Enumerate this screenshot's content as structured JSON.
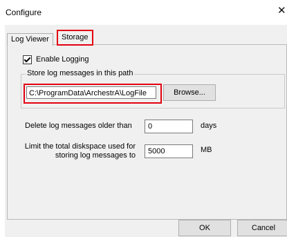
{
  "window": {
    "title": "Configure",
    "close_glyph": "✕"
  },
  "tabs": [
    {
      "label": "Log Viewer",
      "selected": false
    },
    {
      "label": "Storage",
      "selected": true
    }
  ],
  "storage": {
    "enable_logging": {
      "label": "Enable Logging",
      "checked": true
    },
    "path_group": {
      "legend": "Store log messages in this path",
      "path_value": "C:\\ProgramData\\ArchestrA\\LogFile",
      "browse_label": "Browse..."
    },
    "delete_older": {
      "label": "Delete log messages older than",
      "value": "0",
      "unit": "days"
    },
    "disk_limit": {
      "label": "Limit the total diskspace used for storing log messages to",
      "value": "5000",
      "unit": "MB"
    }
  },
  "footer": {
    "ok_label": "OK",
    "cancel_label": "Cancel"
  },
  "colors": {
    "highlight": "#e3000f",
    "dialog_bg": "#f0f0f0"
  }
}
